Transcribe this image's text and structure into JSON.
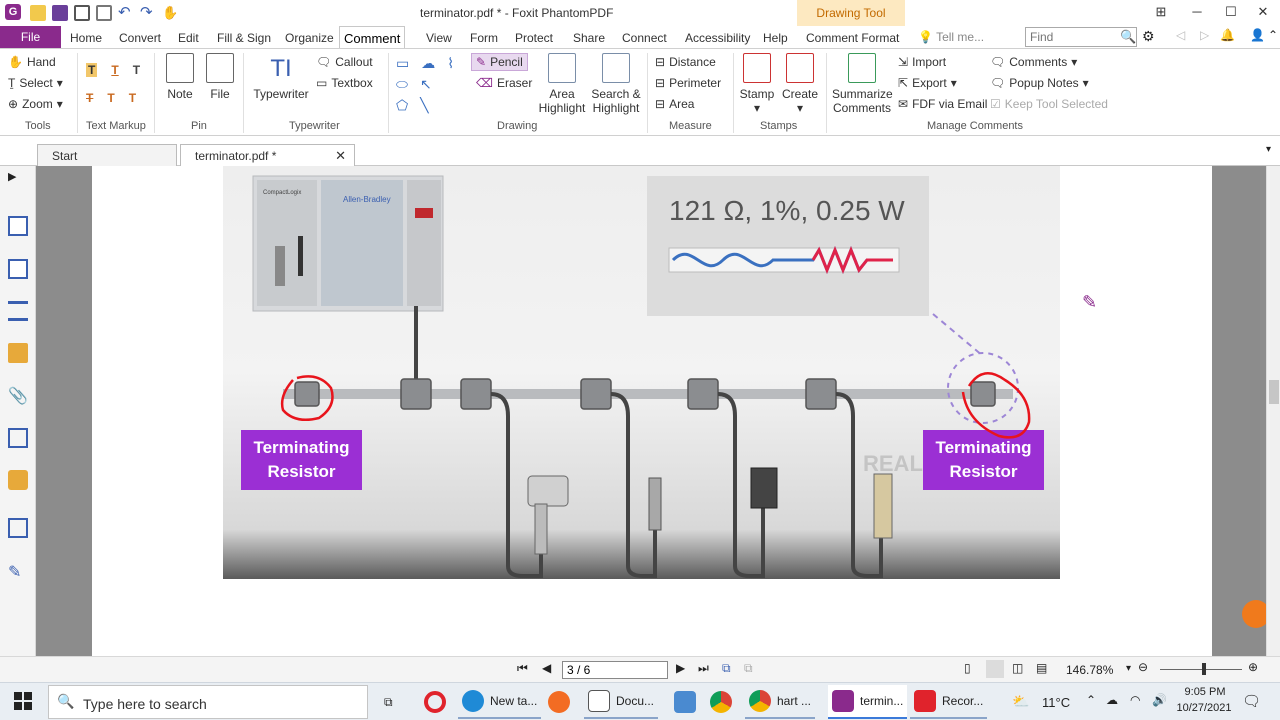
{
  "titlebar": {
    "doc_title": "terminator.pdf * - Foxit PhantomPDF",
    "context_tab": "Drawing Tool"
  },
  "tabs": [
    "File",
    "Home",
    "Convert",
    "Edit",
    "Fill & Sign",
    "Organize",
    "Comment",
    "View",
    "Form",
    "Protect",
    "Share",
    "Connect",
    "Accessibility",
    "Help",
    "Comment Format"
  ],
  "active_tab": "Comment",
  "tellme_placeholder": "Tell me...",
  "find_placeholder": "Find",
  "ribbon": {
    "tools": {
      "label": "Tools",
      "items": [
        "Hand",
        "Select",
        "Zoom"
      ]
    },
    "text_markup": {
      "label": "Text Markup"
    },
    "pin": {
      "label": "Pin",
      "items": [
        "Note",
        "File"
      ]
    },
    "typewriter": {
      "label": "Typewriter",
      "big": "Typewriter",
      "items": [
        "Callout",
        "Textbox"
      ]
    },
    "drawing": {
      "label": "Drawing",
      "items": [
        "Pencil",
        "Eraser"
      ],
      "big": [
        "Area Highlight",
        "Search & Highlight"
      ]
    },
    "measure": {
      "label": "Measure",
      "items": [
        "Distance",
        "Perimeter",
        "Area"
      ]
    },
    "stamps": {
      "label": "Stamps",
      "items": [
        "Stamp",
        "Create"
      ]
    },
    "manage": {
      "label": "Manage Comments",
      "summarize": "Summarize Comments",
      "items": [
        "Import",
        "Export",
        "FDF via Email",
        "Comments",
        "Popup Notes",
        "Keep Tool Selected"
      ]
    }
  },
  "doc_tabs": [
    "Start",
    "terminator.pdf *"
  ],
  "slide": {
    "spec_text": "121 Ω, 1%, 0.25 W",
    "left_label": "Terminating Resistor",
    "right_label": "Terminating Resistor",
    "watermark": "REALPARS",
    "plc_brand": "Allen-Bradley",
    "plc_model": "CompactLogix"
  },
  "status": {
    "page_value": "3 / 6",
    "zoom": "146.78%"
  },
  "taskbar": {
    "search_placeholder": "Type here to search",
    "apps": [
      "New ta...",
      "Docu...",
      "hart ...",
      "termin...",
      "Recor..."
    ],
    "weather": "11°C",
    "time": "9:05 PM",
    "date": "10/27/2021"
  },
  "colors": {
    "brand": "#8a2a8c",
    "label_purple": "#9b2fd4",
    "annotation_red": "#e8141c"
  }
}
